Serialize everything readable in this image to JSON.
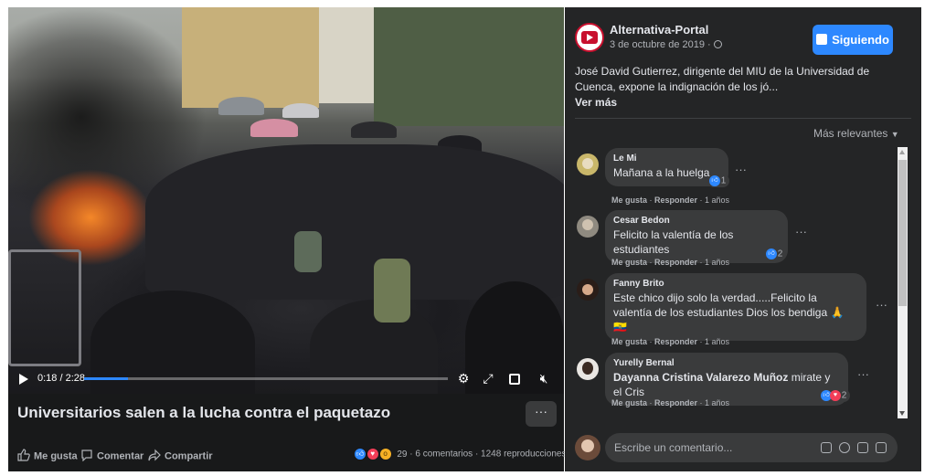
{
  "video": {
    "current_time": "0:18",
    "duration": "2:28",
    "progress": 0.12
  },
  "post": {
    "title": "Universitarios salen a la lucha contra el paquetazo",
    "more_label": "···",
    "actions": {
      "like": "Me gusta",
      "comment": "Comentar",
      "share": "Compartir"
    },
    "reactions_count": "29",
    "stats": "· 6 comentarios · 1248 reproducciones"
  },
  "page": {
    "name": "Alternativa-Portal",
    "date": "3 de octubre de 2019 · ",
    "follow_label": "Siguiendo",
    "text": "José David Gutierrez, dirigente del MIU de la Universidad de Cuenca, expone la indignación de los jó...",
    "see_more": "Ver más",
    "sort_label": "Más relevantes"
  },
  "comments": [
    {
      "author": "Le Mi",
      "text": "Mañana a la huelga",
      "reactions": "1",
      "meta_like": "Me gusta",
      "meta_reply": "Responder",
      "meta_time": " · 1 años"
    },
    {
      "author": "Cesar Bedon",
      "text": "Felicito la valentía de los estudiantes",
      "reactions": "2",
      "meta_like": "Me gusta",
      "meta_reply": "Responder",
      "meta_time": " · 1 años"
    },
    {
      "author": "Fanny Brito",
      "text": "Este chico dijo solo la verdad.....Felicito la valentía de los estudiantes Dios los bendiga 🙏🇪🇨",
      "meta_like": "Me gusta",
      "meta_reply": "Responder",
      "meta_time": " · 1 años"
    },
    {
      "author": "Yurelly Bernal",
      "mention": "Dayanna Cristina Valarezo Muñoz",
      "text": " mirate y el Cris",
      "reactions": "2",
      "meta_like": "Me gusta",
      "meta_reply": "Responder",
      "meta_time": " · 1 años"
    }
  ],
  "comment_input": {
    "placeholder": "Escribe un comentario..."
  },
  "icons": [
    "play-icon",
    "settings-icon",
    "expand-icon",
    "pip-icon",
    "volume-icon",
    "like-icon",
    "comment-icon",
    "share-icon",
    "globe-icon",
    "camera-icon",
    "emoji-icon",
    "gif-icon",
    "sticker-icon"
  ],
  "colors": {
    "accent": "#2d88ff",
    "panel_bg": "#242526",
    "left_bg": "#18191a",
    "bubble_bg": "#3a3b3c"
  }
}
